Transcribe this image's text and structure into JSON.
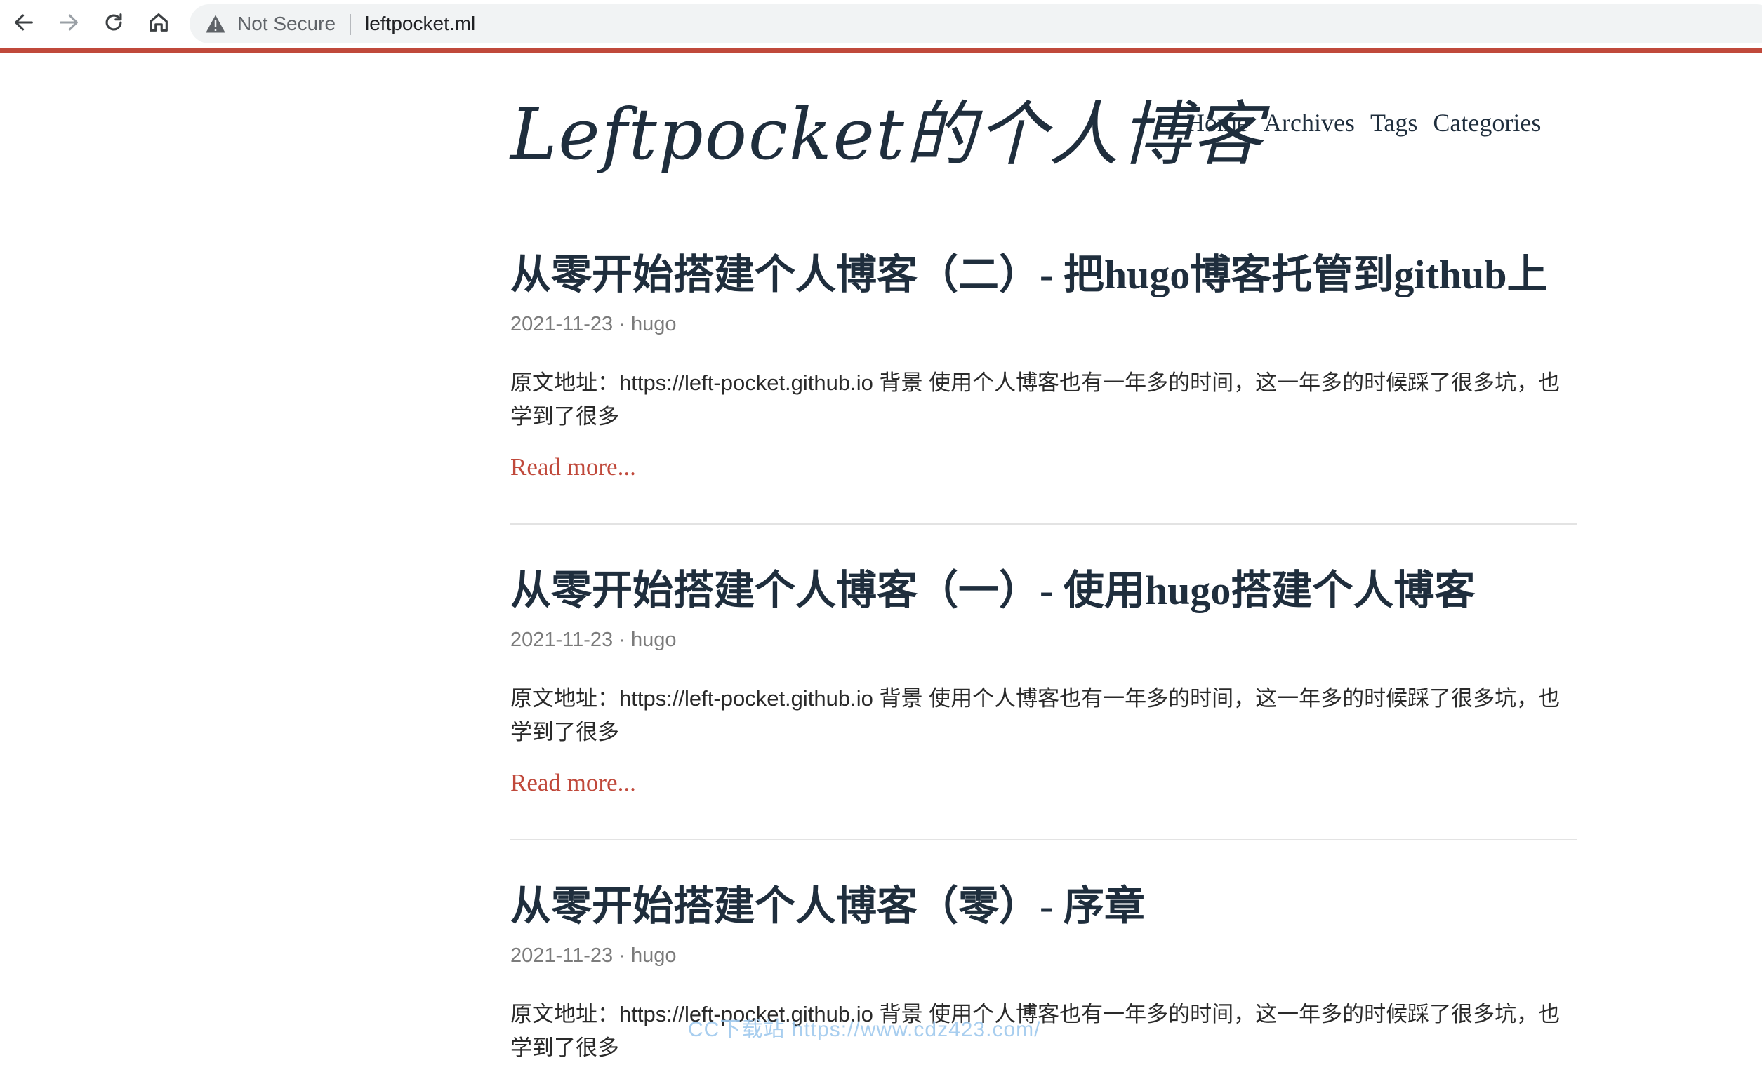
{
  "browser": {
    "security_text": "Not Secure",
    "url": "leftpocket.ml",
    "accent_color": "#c0493b"
  },
  "site": {
    "title": "Leftpocket的个人博客",
    "nav": [
      "Home",
      "Archives",
      "Tags",
      "Categories"
    ]
  },
  "posts": [
    {
      "title": "从零开始搭建个人博客（二）- 把hugo博客托管到github上",
      "meta": "2021-11-23 · hugo",
      "excerpt": "原文地址：https://left-pocket.github.io 背景 使用个人博客也有一年多的时间，这一年多的时候踩了很多坑，也学到了很多",
      "read_more": "Read more..."
    },
    {
      "title": "从零开始搭建个人博客（一）- 使用hugo搭建个人博客",
      "meta": "2021-11-23 · hugo",
      "excerpt": "原文地址：https://left-pocket.github.io 背景 使用个人博客也有一年多的时间，这一年多的时候踩了很多坑，也学到了很多",
      "read_more": "Read more..."
    },
    {
      "title": "从零开始搭建个人博客（零）- 序章",
      "meta": "2021-11-23 · hugo",
      "excerpt": "原文地址：https://left-pocket.github.io 背景 使用个人博客也有一年多的时间，这一年多的时候踩了很多坑，也学到了很多"
    }
  ],
  "watermark": "CC下载站 https://www.cdz423.com/"
}
